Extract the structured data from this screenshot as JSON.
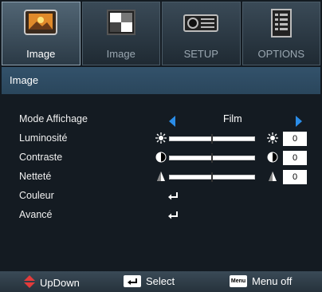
{
  "tabs": [
    {
      "label": "Image",
      "icon": "image-icon",
      "active": true
    },
    {
      "label": "Image",
      "icon": "image-advanced-icon",
      "active": false
    },
    {
      "label": "SETUP",
      "icon": "projector-icon",
      "active": false
    },
    {
      "label": "OPTIONS",
      "icon": "options-list-icon",
      "active": false
    }
  ],
  "title": "Image",
  "rows": {
    "mode": {
      "label": "Mode Affichage",
      "value": "Film"
    },
    "brightness": {
      "label": "Luminosité",
      "value": "0",
      "level": 0.5
    },
    "contrast": {
      "label": "Contraste",
      "value": "0",
      "level": 0.5
    },
    "sharpness": {
      "label": "Netteté",
      "value": "0",
      "level": 0.5
    },
    "color": {
      "label": "Couleur"
    },
    "advanced": {
      "label": "Avancé"
    }
  },
  "footer": {
    "updown": "UpDown",
    "select": "Select",
    "menu_key": "Menu",
    "menu_off": "Menu off"
  },
  "colors": {
    "accent": "#2b8de8",
    "updown_arrow": "#e33b3b"
  }
}
